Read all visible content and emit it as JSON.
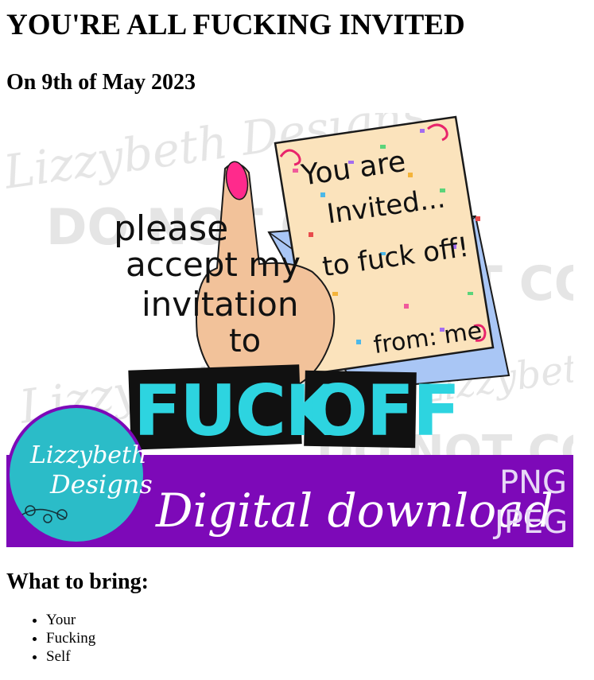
{
  "heading": {
    "title": "YOU'RE ALL FUCKING INVITED",
    "date": "On 9th of May 2023"
  },
  "image": {
    "watermark_brand": "Lizzybeth Designs",
    "watermark_notice": "DO NOT COPY",
    "lettering_line1": "please",
    "lettering_line2": "accept my",
    "lettering_line3": "invitation",
    "lettering_line4": "to",
    "note_line1": "You are",
    "note_line2": "Invited...",
    "note_line3": "to fuck off!",
    "note_line4": "from: me",
    "banner_word1": "FUCK",
    "banner_word2": "OFF",
    "logo_line1": "Lizzybeth",
    "logo_line2": "Designs",
    "ribbon_text": "Digital download",
    "format1": "PNG",
    "format2": "JPEG",
    "colors": {
      "ribbon": "#7d09b8",
      "logo_circle": "#2bbcc8",
      "paper": "#fbe3bc",
      "envelope": "#a9c6f5",
      "nail": "#ff2a8c",
      "skin": "#f2c29a",
      "block_text": "#2dd4e0"
    }
  },
  "bring": {
    "heading": "What to bring:",
    "items": [
      "Your",
      "Fucking",
      "Self"
    ]
  }
}
